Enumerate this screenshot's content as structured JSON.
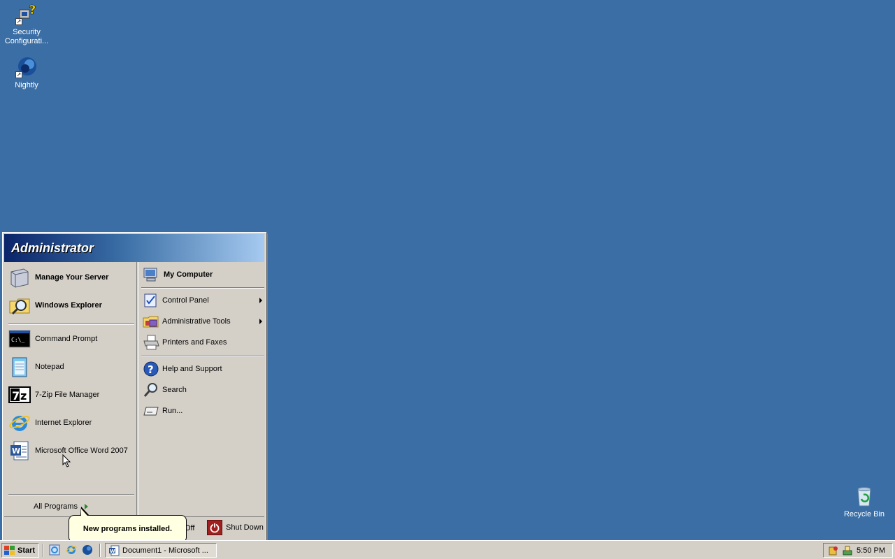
{
  "desktop": {
    "icons": [
      {
        "label": "Security Configurati...",
        "icon": "security-config-icon"
      },
      {
        "label": "Nightly",
        "icon": "nightly-browser-icon"
      },
      {
        "label": "Recycle Bin",
        "icon": "recycle-bin-icon"
      }
    ]
  },
  "start_menu": {
    "user": "Administrator",
    "pinned": [
      {
        "label": "Manage Your Server",
        "icon": "server-icon"
      },
      {
        "label": "Windows Explorer",
        "icon": "explorer-icon"
      }
    ],
    "recent": [
      {
        "label": "Command Prompt",
        "icon": "cmd-icon"
      },
      {
        "label": "Notepad",
        "icon": "notepad-icon"
      },
      {
        "label": "7-Zip File Manager",
        "icon": "7zip-icon"
      },
      {
        "label": "Internet Explorer",
        "icon": "ie-icon"
      },
      {
        "label": "Microsoft Office Word 2007",
        "icon": "word-icon"
      }
    ],
    "all_programs": "All Programs",
    "right": {
      "my_computer": "My Computer",
      "control_panel": "Control Panel",
      "admin_tools": "Administrative Tools",
      "printers": "Printers and Faxes",
      "help": "Help and Support",
      "search": "Search",
      "run": "Run..."
    },
    "footer": {
      "log_off": "Off",
      "shut_down": "Shut Down"
    }
  },
  "balloon": {
    "text": "New programs installed."
  },
  "taskbar": {
    "start_label": "Start",
    "task_label": "Document1 - Microsoft ...",
    "clock": "5:50 PM"
  },
  "colors": {
    "desktop": "#3a6ea5",
    "menu_face": "#d4d0c8",
    "header_start": "#0a246a",
    "header_end": "#a6caf0",
    "balloon": "#ffffe1"
  }
}
